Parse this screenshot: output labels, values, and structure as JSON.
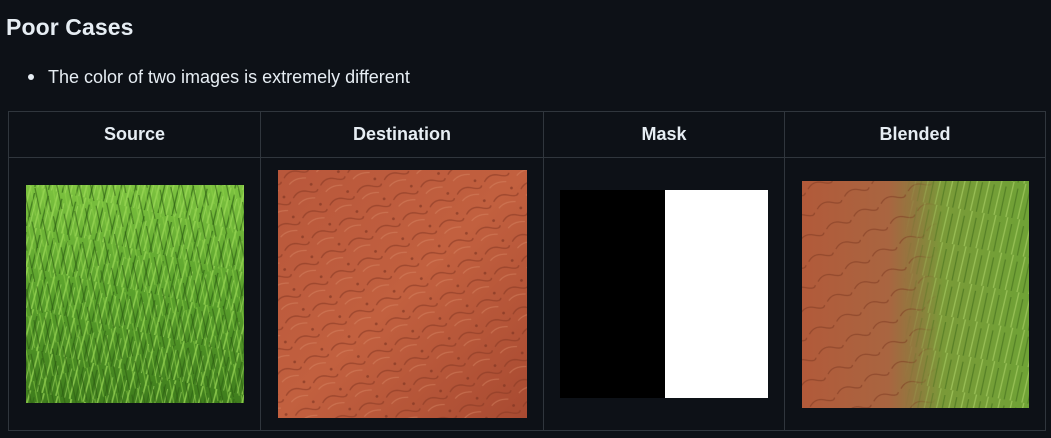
{
  "heading": {
    "title": "Poor Cases",
    "anchor_icon": "link-icon"
  },
  "bullets": [
    "The color of two images is extremely different"
  ],
  "table": {
    "headers": [
      "Source",
      "Destination",
      "Mask",
      "Blended"
    ],
    "images": [
      {
        "name": "grass-image",
        "description_icon": "grass-texture"
      },
      {
        "name": "red-soil-image",
        "description_icon": "soil-texture"
      },
      {
        "name": "mask-image",
        "description_icon": "half-black-half-white"
      },
      {
        "name": "blended-image",
        "description_icon": "soil-grass-blend"
      }
    ]
  },
  "colors": {
    "background": "#0d1117",
    "text": "#e6edf3",
    "border": "#30363d",
    "grass": "#5aa02c",
    "soil": "#b5533a"
  }
}
